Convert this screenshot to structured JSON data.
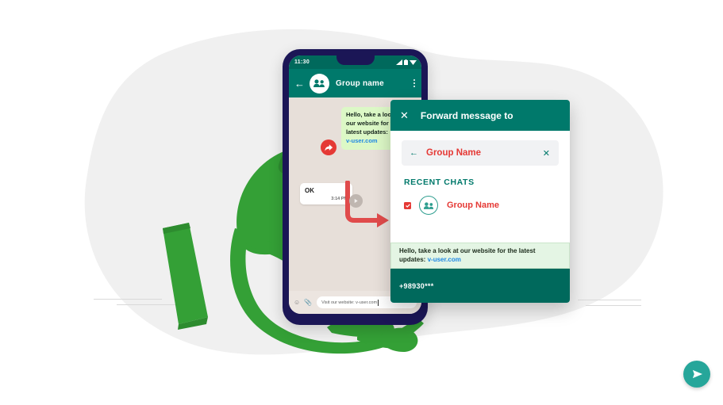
{
  "illustration": {
    "background_blob_color": "#f0f0f0",
    "accent_green": "#34a036",
    "hand_color": "#34a036",
    "decor_lines": "#d9d9d9"
  },
  "phone": {
    "frame_color": "#1b1656",
    "screen_bg": "#e7dfd9",
    "status_bar": {
      "time": "11:30",
      "icons": [
        "signal-icon",
        "battery-icon",
        "wifi-icon"
      ]
    },
    "chat_header": {
      "back_icon": "back-arrow-icon",
      "avatar_icon": "group-avatar-icon",
      "title": "Group name",
      "menu_icon": "overflow-menu-icon",
      "bg_color": "#00796b"
    },
    "messages": [
      {
        "type": "outgoing",
        "text": "Hello, take a look at our website for the latest updates:",
        "link": "v-user.com",
        "bg_color": "#dcf8c6"
      },
      {
        "type": "incoming",
        "text": "OK",
        "time": "3:14 PM",
        "bg_color": "#ffffff"
      }
    ],
    "input_bar": {
      "emoji_icon": "emoji-icon",
      "attach_icon": "attachment-icon",
      "value": "Visit our website: v-user.com"
    }
  },
  "forward_dialog": {
    "header": {
      "close_icon": "close-icon",
      "title": "Forward message to",
      "bg_color": "#00796b"
    },
    "search": {
      "back_icon": "back-arrow-icon",
      "value": "Group Name",
      "clear_icon": "clear-icon",
      "value_color": "#e53935"
    },
    "section_label": "RECENT CHATS",
    "chats": [
      {
        "checked": true,
        "checkbox_color": "#e53935",
        "avatar_icon": "group-avatar-icon",
        "name": "Group Name"
      }
    ],
    "preview": {
      "text": "Hello, take a look at our website for the latest updates:",
      "link": "v-user.com",
      "bg_color": "#e4f5e4"
    },
    "footer": {
      "phone_number": "+98930***",
      "send_icon": "send-icon",
      "send_button_color": "#26a69a",
      "bg_color": "#00695c"
    }
  },
  "markers": {
    "forward_badge_icon": "forward-arrow-icon",
    "forward_badge_color": "#e53935",
    "flow_arrow_icon": "flow-arrow-icon",
    "flow_arrow_color": "#e04b4b",
    "drag_handle_icon": "drag-handle-icon"
  }
}
